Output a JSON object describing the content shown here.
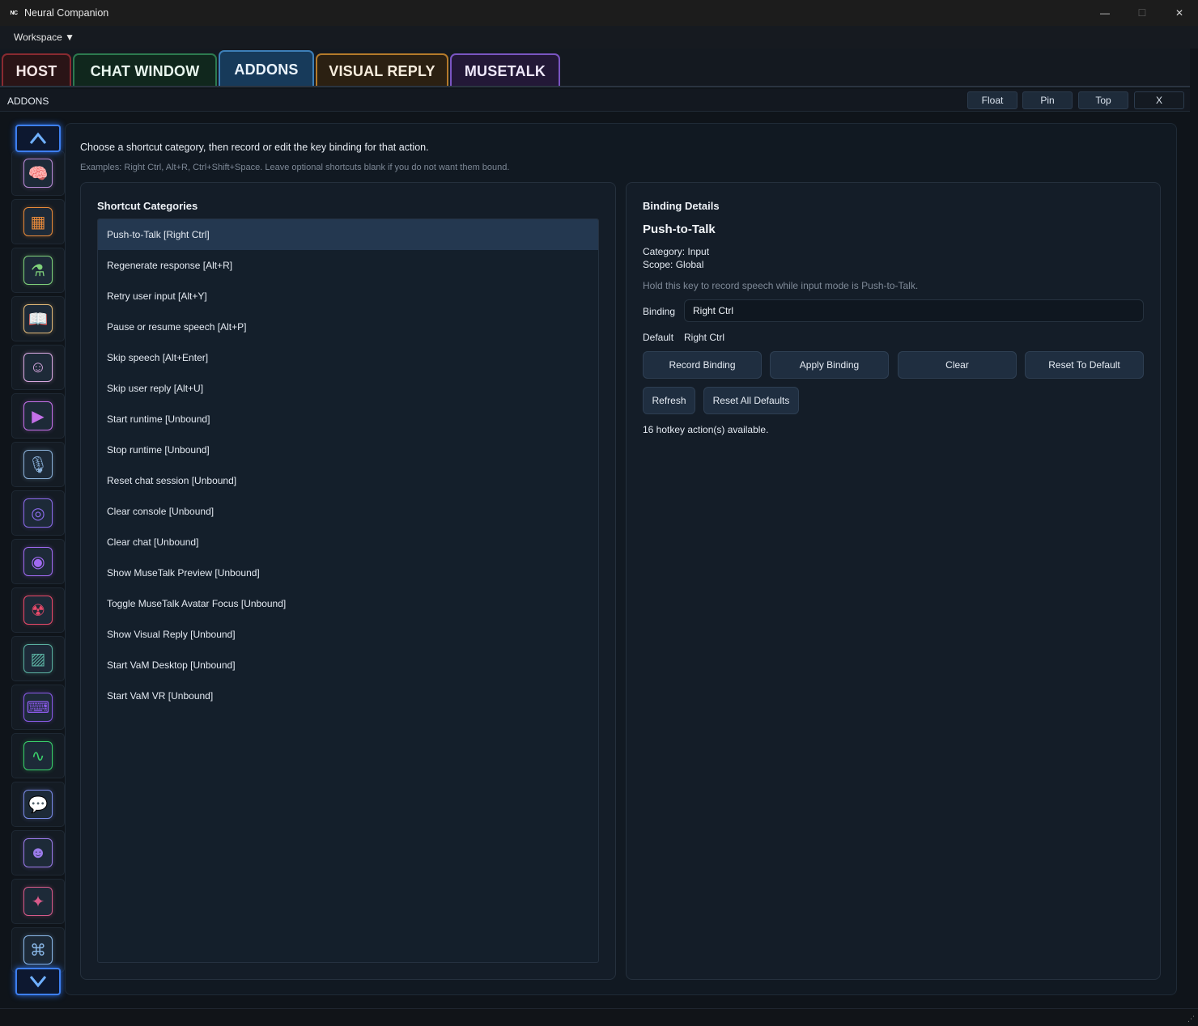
{
  "window": {
    "logo": "NC",
    "title": "Neural Companion",
    "controls": {
      "minimize": "—",
      "maximize": "☐",
      "close": "✕"
    }
  },
  "menu": {
    "workspace": "Workspace ▼"
  },
  "tabs": [
    {
      "label": "HOST",
      "color": "#8a2a30"
    },
    {
      "label": "CHAT WINDOW",
      "color": "#2c7a4f"
    },
    {
      "label": "ADDONS",
      "color": "#3d7fb8"
    },
    {
      "label": "VISUAL REPLY",
      "color": "#b47a2a"
    },
    {
      "label": "MUSETALK",
      "color": "#7a55c2"
    }
  ],
  "addons_header": {
    "title": "ADDONS",
    "buttons": {
      "float": "Float",
      "pin": "Pin",
      "top": "Top",
      "close": "X"
    }
  },
  "sidebar": {
    "scroll_up_icon": "chevron-up-icon",
    "scroll_down_icon": "chevron-down-icon",
    "items": [
      {
        "icon": "brain-icon",
        "color": "#b88ad6"
      },
      {
        "icon": "dashboard-icon",
        "color": "#e88a3a"
      },
      {
        "icon": "flask-icon",
        "color": "#7fd07a"
      },
      {
        "icon": "book-icon",
        "color": "#e0b878"
      },
      {
        "icon": "mask-icon",
        "color": "#d8a8e0"
      },
      {
        "icon": "media-icon",
        "color": "#c470e8"
      },
      {
        "icon": "microphone-icon",
        "color": "#8ab0d8"
      },
      {
        "icon": "target-icon",
        "color": "#8a6ae8"
      },
      {
        "icon": "orb-icon",
        "color": "#a06af0"
      },
      {
        "icon": "robot-icon",
        "color": "#e84a6a"
      },
      {
        "icon": "image-icon",
        "color": "#5ab0a0"
      },
      {
        "icon": "keyboard-icon",
        "color": "#8a5ae8"
      },
      {
        "icon": "waveform-icon",
        "color": "#3ad06a"
      },
      {
        "icon": "chat-bubbles-icon",
        "color": "#7a8ae8"
      },
      {
        "icon": "discord-icon",
        "color": "#9a7ae8"
      },
      {
        "icon": "network-icon",
        "color": "#d85a8a"
      },
      {
        "icon": "hotkeys-icon",
        "color": "#8ab8e8"
      }
    ]
  },
  "intro": {
    "line1": "Choose a shortcut category, then record or edit the key binding for that action.",
    "line2": "Examples: Right Ctrl, Alt+R, Ctrl+Shift+Space. Leave optional shortcuts blank if you do not want them bound."
  },
  "categories": {
    "title": "Shortcut Categories",
    "items": [
      "Push-to-Talk  [Right Ctrl]",
      "Regenerate response  [Alt+R]",
      "Retry user input  [Alt+Y]",
      "Pause or resume speech  [Alt+P]",
      "Skip speech  [Alt+Enter]",
      "Skip user reply  [Alt+U]",
      "Start runtime  [Unbound]",
      "Stop runtime  [Unbound]",
      "Reset chat session  [Unbound]",
      "Clear console  [Unbound]",
      "Clear chat  [Unbound]",
      "Show MuseTalk Preview  [Unbound]",
      "Toggle MuseTalk Avatar Focus  [Unbound]",
      "Show Visual Reply  [Unbound]",
      "Start VaM Desktop  [Unbound]",
      "Start VaM VR  [Unbound]"
    ],
    "selected_index": 0
  },
  "details": {
    "title": "Binding Details",
    "name": "Push-to-Talk",
    "category": "Category: Input",
    "scope": "Scope: Global",
    "description": "Hold this key to record speech while input mode is Push-to-Talk.",
    "binding_label": "Binding",
    "binding_value": "Right Ctrl",
    "default_label": "Default",
    "default_value": "Right Ctrl",
    "buttons": {
      "record": "Record Binding",
      "apply": "Apply Binding",
      "clear": "Clear",
      "reset": "Reset To Default",
      "refresh": "Refresh",
      "reset_all": "Reset All Defaults"
    },
    "status": "16 hotkey action(s) available."
  }
}
